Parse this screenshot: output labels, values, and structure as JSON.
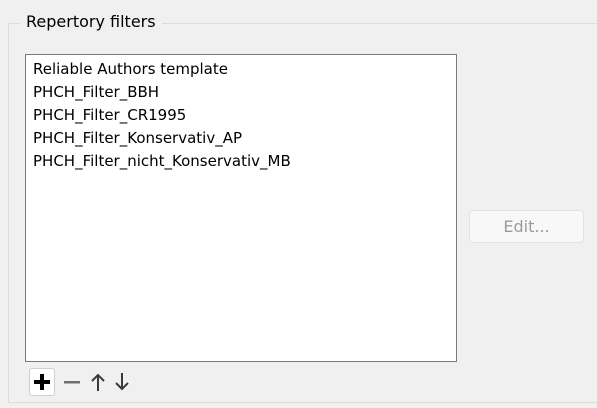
{
  "group": {
    "title": "Repertory filters"
  },
  "filters": {
    "items": [
      "Reliable Authors template",
      "PHCH_Filter_BBH",
      "PHCH_Filter_CR1995",
      "PHCH_Filter_Konservativ_AP",
      "PHCH_Filter_nicht_Konservativ_MB"
    ]
  },
  "actions": {
    "edit_label": "Edit..."
  },
  "toolbar": {
    "icons": [
      "plus-icon",
      "minus-icon",
      "arrow-up-icon",
      "arrow-down-icon"
    ]
  },
  "colors": {
    "background": "#f0f0f0",
    "list_border": "#7a7a7a",
    "disabled_text": "#9b9b9b",
    "icon_active": "#000000",
    "icon_inactive": "#6e6e6e"
  }
}
